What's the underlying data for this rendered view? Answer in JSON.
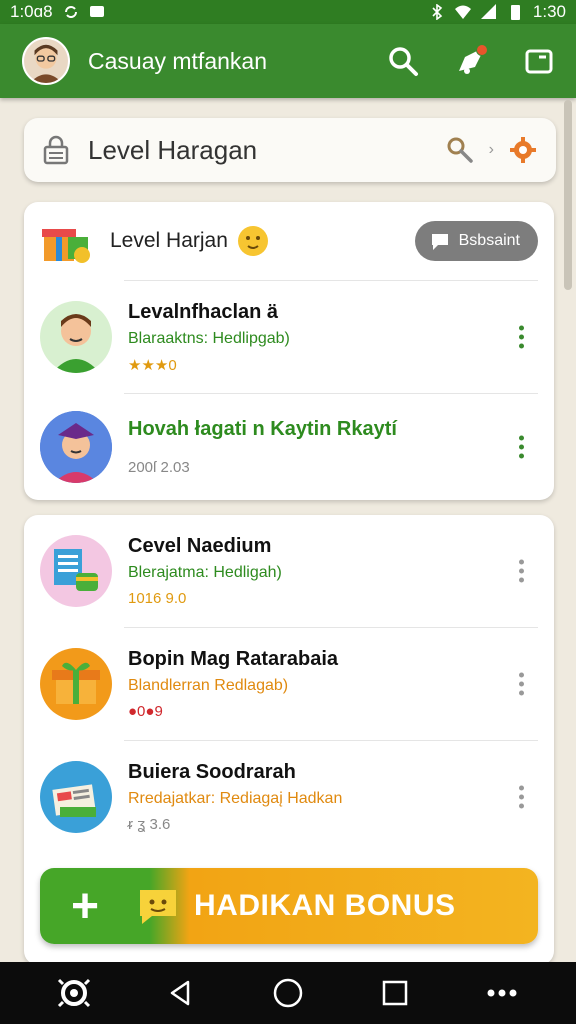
{
  "status_bar": {
    "time_left": "1:0ɑ8",
    "time_right": "1:30"
  },
  "app_bar": {
    "title": "Casuay mtfankan"
  },
  "search": {
    "text": "Level Haragan"
  },
  "card1": {
    "header_title": "Level Harjan",
    "pill_label": "Bsbsaint",
    "rows": [
      {
        "title": "Levalnfhaclan ä",
        "subtitle": "Blaraaktns: Hedlipgab)",
        "meta": "★★★0",
        "sub_color": "#2e8b1f",
        "meta_color": "#e09a10"
      },
      {
        "title": "Hovah łagati n Kaytin Rkaytí",
        "subtitle": "",
        "meta": "200ſ 2.03",
        "sub_color": "#2e8b1f",
        "meta_color": "#888888"
      }
    ]
  },
  "card2": {
    "rows": [
      {
        "title": "Cevel Naedium",
        "subtitle": "Blerajatma: Hedligah)",
        "meta": "1016 9.0",
        "sub_color": "#2e8b1f",
        "meta_color": "#e09a10"
      },
      {
        "title": "Bopin Mag Ratarabaia",
        "subtitle": "Blandlerran Redlagab)",
        "meta": "●0●9",
        "sub_color": "#e08a10",
        "meta_color": "#d0282d"
      },
      {
        "title": "Buiera Soodrarah",
        "subtitle": "Rredajatkar: Rediagaį Hadkan",
        "meta": "ᵲ ʓ 3.6",
        "sub_color": "#e08a10",
        "meta_color": "#888888"
      }
    ]
  },
  "bonus_button": {
    "label": "HADIKAN BONUS"
  },
  "colors": {
    "primary": "#3a8a2e",
    "accent": "#f2a414",
    "statusbar": "#2f7d22"
  },
  "icons": [
    "wifi-icon",
    "signal-icon",
    "battery-icon",
    "search-icon",
    "notification-icon",
    "window-icon",
    "lock-icon",
    "key-icon",
    "gear-icon",
    "more-vert-icon",
    "back-icon",
    "home-icon",
    "recents-icon",
    "menu-dots-icon"
  ]
}
